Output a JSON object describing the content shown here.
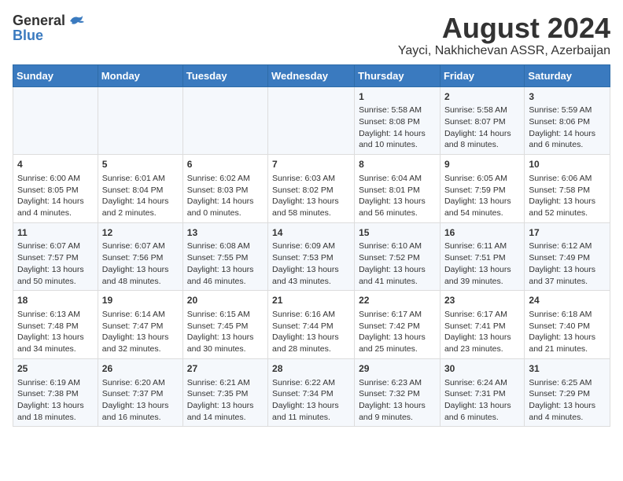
{
  "header": {
    "logo_general": "General",
    "logo_blue": "Blue",
    "month_title": "August 2024",
    "location": "Yayci, Nakhichevan ASSR, Azerbaijan"
  },
  "days_of_week": [
    "Sunday",
    "Monday",
    "Tuesday",
    "Wednesday",
    "Thursday",
    "Friday",
    "Saturday"
  ],
  "weeks": [
    [
      {
        "day": "",
        "info": ""
      },
      {
        "day": "",
        "info": ""
      },
      {
        "day": "",
        "info": ""
      },
      {
        "day": "",
        "info": ""
      },
      {
        "day": "1",
        "info": "Sunrise: 5:58 AM\nSunset: 8:08 PM\nDaylight: 14 hours\nand 10 minutes."
      },
      {
        "day": "2",
        "info": "Sunrise: 5:58 AM\nSunset: 8:07 PM\nDaylight: 14 hours\nand 8 minutes."
      },
      {
        "day": "3",
        "info": "Sunrise: 5:59 AM\nSunset: 8:06 PM\nDaylight: 14 hours\nand 6 minutes."
      }
    ],
    [
      {
        "day": "4",
        "info": "Sunrise: 6:00 AM\nSunset: 8:05 PM\nDaylight: 14 hours\nand 4 minutes."
      },
      {
        "day": "5",
        "info": "Sunrise: 6:01 AM\nSunset: 8:04 PM\nDaylight: 14 hours\nand 2 minutes."
      },
      {
        "day": "6",
        "info": "Sunrise: 6:02 AM\nSunset: 8:03 PM\nDaylight: 14 hours\nand 0 minutes."
      },
      {
        "day": "7",
        "info": "Sunrise: 6:03 AM\nSunset: 8:02 PM\nDaylight: 13 hours\nand 58 minutes."
      },
      {
        "day": "8",
        "info": "Sunrise: 6:04 AM\nSunset: 8:01 PM\nDaylight: 13 hours\nand 56 minutes."
      },
      {
        "day": "9",
        "info": "Sunrise: 6:05 AM\nSunset: 7:59 PM\nDaylight: 13 hours\nand 54 minutes."
      },
      {
        "day": "10",
        "info": "Sunrise: 6:06 AM\nSunset: 7:58 PM\nDaylight: 13 hours\nand 52 minutes."
      }
    ],
    [
      {
        "day": "11",
        "info": "Sunrise: 6:07 AM\nSunset: 7:57 PM\nDaylight: 13 hours\nand 50 minutes."
      },
      {
        "day": "12",
        "info": "Sunrise: 6:07 AM\nSunset: 7:56 PM\nDaylight: 13 hours\nand 48 minutes."
      },
      {
        "day": "13",
        "info": "Sunrise: 6:08 AM\nSunset: 7:55 PM\nDaylight: 13 hours\nand 46 minutes."
      },
      {
        "day": "14",
        "info": "Sunrise: 6:09 AM\nSunset: 7:53 PM\nDaylight: 13 hours\nand 43 minutes."
      },
      {
        "day": "15",
        "info": "Sunrise: 6:10 AM\nSunset: 7:52 PM\nDaylight: 13 hours\nand 41 minutes."
      },
      {
        "day": "16",
        "info": "Sunrise: 6:11 AM\nSunset: 7:51 PM\nDaylight: 13 hours\nand 39 minutes."
      },
      {
        "day": "17",
        "info": "Sunrise: 6:12 AM\nSunset: 7:49 PM\nDaylight: 13 hours\nand 37 minutes."
      }
    ],
    [
      {
        "day": "18",
        "info": "Sunrise: 6:13 AM\nSunset: 7:48 PM\nDaylight: 13 hours\nand 34 minutes."
      },
      {
        "day": "19",
        "info": "Sunrise: 6:14 AM\nSunset: 7:47 PM\nDaylight: 13 hours\nand 32 minutes."
      },
      {
        "day": "20",
        "info": "Sunrise: 6:15 AM\nSunset: 7:45 PM\nDaylight: 13 hours\nand 30 minutes."
      },
      {
        "day": "21",
        "info": "Sunrise: 6:16 AM\nSunset: 7:44 PM\nDaylight: 13 hours\nand 28 minutes."
      },
      {
        "day": "22",
        "info": "Sunrise: 6:17 AM\nSunset: 7:42 PM\nDaylight: 13 hours\nand 25 minutes."
      },
      {
        "day": "23",
        "info": "Sunrise: 6:17 AM\nSunset: 7:41 PM\nDaylight: 13 hours\nand 23 minutes."
      },
      {
        "day": "24",
        "info": "Sunrise: 6:18 AM\nSunset: 7:40 PM\nDaylight: 13 hours\nand 21 minutes."
      }
    ],
    [
      {
        "day": "25",
        "info": "Sunrise: 6:19 AM\nSunset: 7:38 PM\nDaylight: 13 hours\nand 18 minutes."
      },
      {
        "day": "26",
        "info": "Sunrise: 6:20 AM\nSunset: 7:37 PM\nDaylight: 13 hours\nand 16 minutes."
      },
      {
        "day": "27",
        "info": "Sunrise: 6:21 AM\nSunset: 7:35 PM\nDaylight: 13 hours\nand 14 minutes."
      },
      {
        "day": "28",
        "info": "Sunrise: 6:22 AM\nSunset: 7:34 PM\nDaylight: 13 hours\nand 11 minutes."
      },
      {
        "day": "29",
        "info": "Sunrise: 6:23 AM\nSunset: 7:32 PM\nDaylight: 13 hours\nand 9 minutes."
      },
      {
        "day": "30",
        "info": "Sunrise: 6:24 AM\nSunset: 7:31 PM\nDaylight: 13 hours\nand 6 minutes."
      },
      {
        "day": "31",
        "info": "Sunrise: 6:25 AM\nSunset: 7:29 PM\nDaylight: 13 hours\nand 4 minutes."
      }
    ]
  ]
}
